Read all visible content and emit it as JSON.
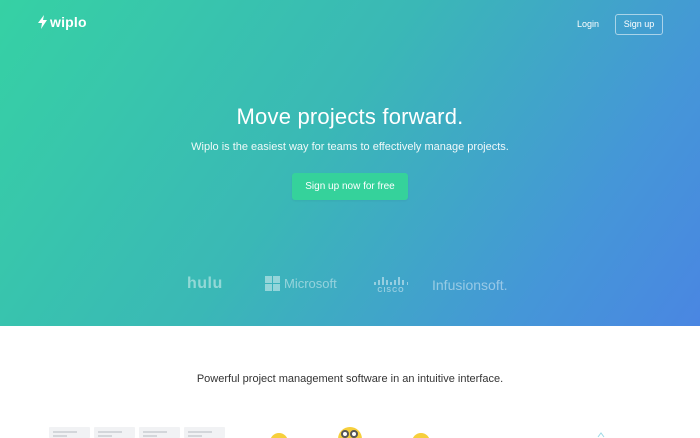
{
  "header": {
    "logo_text": "wiplo",
    "login_label": "Login",
    "signup_label": "Sign up"
  },
  "hero": {
    "title": "Move projects forward.",
    "subtitle": "Wiplo is the easiest way for teams to effectively manage projects.",
    "cta_label": "Sign up now for free",
    "gradient_start": "#36d1a4",
    "gradient_end": "#4a86e2",
    "cta_color": "#35d29b"
  },
  "customers": {
    "logos": [
      "hulu",
      "Microsoft",
      "CISCO",
      "Infusionsoft."
    ]
  },
  "features": {
    "tagline": "Powerful project management software in an intuitive interface."
  }
}
